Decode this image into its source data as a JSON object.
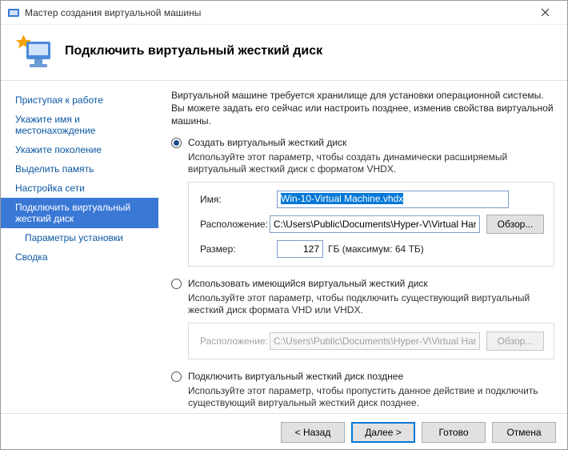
{
  "window": {
    "title": "Мастер создания виртуальной машины",
    "heading": "Подключить виртуальный жесткий диск"
  },
  "sidebar": {
    "items": [
      {
        "label": "Приступая к работе"
      },
      {
        "label": "Укажите имя и местонахождение"
      },
      {
        "label": "Укажите поколение"
      },
      {
        "label": "Выделить память"
      },
      {
        "label": "Настройка сети"
      },
      {
        "label": "Подключить виртуальный жесткий диск"
      },
      {
        "label": "Параметры установки"
      },
      {
        "label": "Сводка"
      }
    ]
  },
  "main": {
    "intro": "Виртуальной машине требуется хранилище для установки операционной системы. Вы можете задать его сейчас или настроить позднее, изменив свойства виртуальной машины.",
    "opt1": {
      "title": "Создать виртуальный жесткий диск",
      "desc": "Используйте этот параметр, чтобы создать динамически расширяемый виртуальный жесткий диск с форматом VHDX.",
      "name_label": "Имя:",
      "name_value": "Win-10-Virtual Machine.vhdx",
      "loc_label": "Расположение:",
      "loc_value": "C:\\Users\\Public\\Documents\\Hyper-V\\Virtual Hard Disks\\",
      "browse": "Обзор...",
      "size_label": "Размер:",
      "size_value": "127",
      "size_suffix": "ГБ (максимум: 64 ТБ)"
    },
    "opt2": {
      "title": "Использовать имеющийся виртуальный жесткий диск",
      "desc": "Используйте этот параметр, чтобы подключить существующий виртуальный жесткий диск формата VHD или VHDX.",
      "loc_label": "Расположение:",
      "loc_value": "C:\\Users\\Public\\Documents\\Hyper-V\\Virtual Hard Disks\\",
      "browse": "Обзор..."
    },
    "opt3": {
      "title": "Подключить виртуальный жесткий диск позднее",
      "desc": "Используйте этот параметр, чтобы пропустить данное действие и подключить существующий виртуальный жесткий диск позднее."
    }
  },
  "footer": {
    "back": "< Назад",
    "next": "Далее >",
    "finish": "Готово",
    "cancel": "Отмена"
  }
}
